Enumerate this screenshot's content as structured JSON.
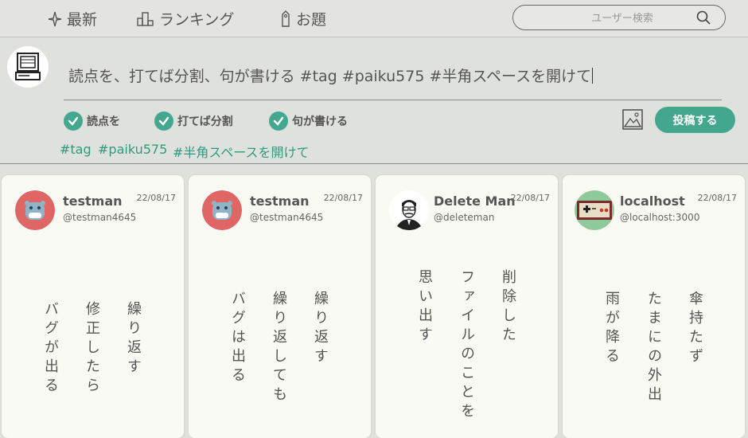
{
  "nav": {
    "latest": "最新",
    "ranking": "ランキング",
    "topics": "お題",
    "search_placeholder": "ユーザー検索"
  },
  "composer": {
    "text": "読点を、打てば分割、句が書ける #tag #paiku575 #半角スペースを開けて",
    "phrases": [
      "読点を",
      "打てば分割",
      "句が書ける"
    ],
    "tags": [
      "#tag",
      "#paiku575",
      "#半角スペースを開けて"
    ],
    "post_label": "投稿する"
  },
  "colors": {
    "accent": "#43a78d",
    "background": "#dfe1dc",
    "card": "#f8faf3"
  },
  "posts": [
    {
      "name": "testman",
      "handle": "@testman4645",
      "date": "22/08/17",
      "avatar": "hippo-icon",
      "lines": [
        "繰り返す",
        "修正したら",
        "バグが出る"
      ]
    },
    {
      "name": "testman",
      "handle": "@testman4645",
      "date": "22/08/17",
      "avatar": "hippo-icon",
      "lines": [
        "繰り返す",
        "繰り返しても",
        "バグは出る"
      ]
    },
    {
      "name": "Delete Man",
      "handle": "@deleteman",
      "date": "22/08/17",
      "avatar": "person-icon",
      "lines": [
        "削除した",
        "ファイルのことを",
        "思い出す"
      ]
    },
    {
      "name": "localhost",
      "handle": "@localhost:3000",
      "date": "22/08/17",
      "avatar": "game-controller-icon",
      "lines": [
        "傘持たず",
        "たまにの外出",
        "雨が降る"
      ]
    }
  ]
}
